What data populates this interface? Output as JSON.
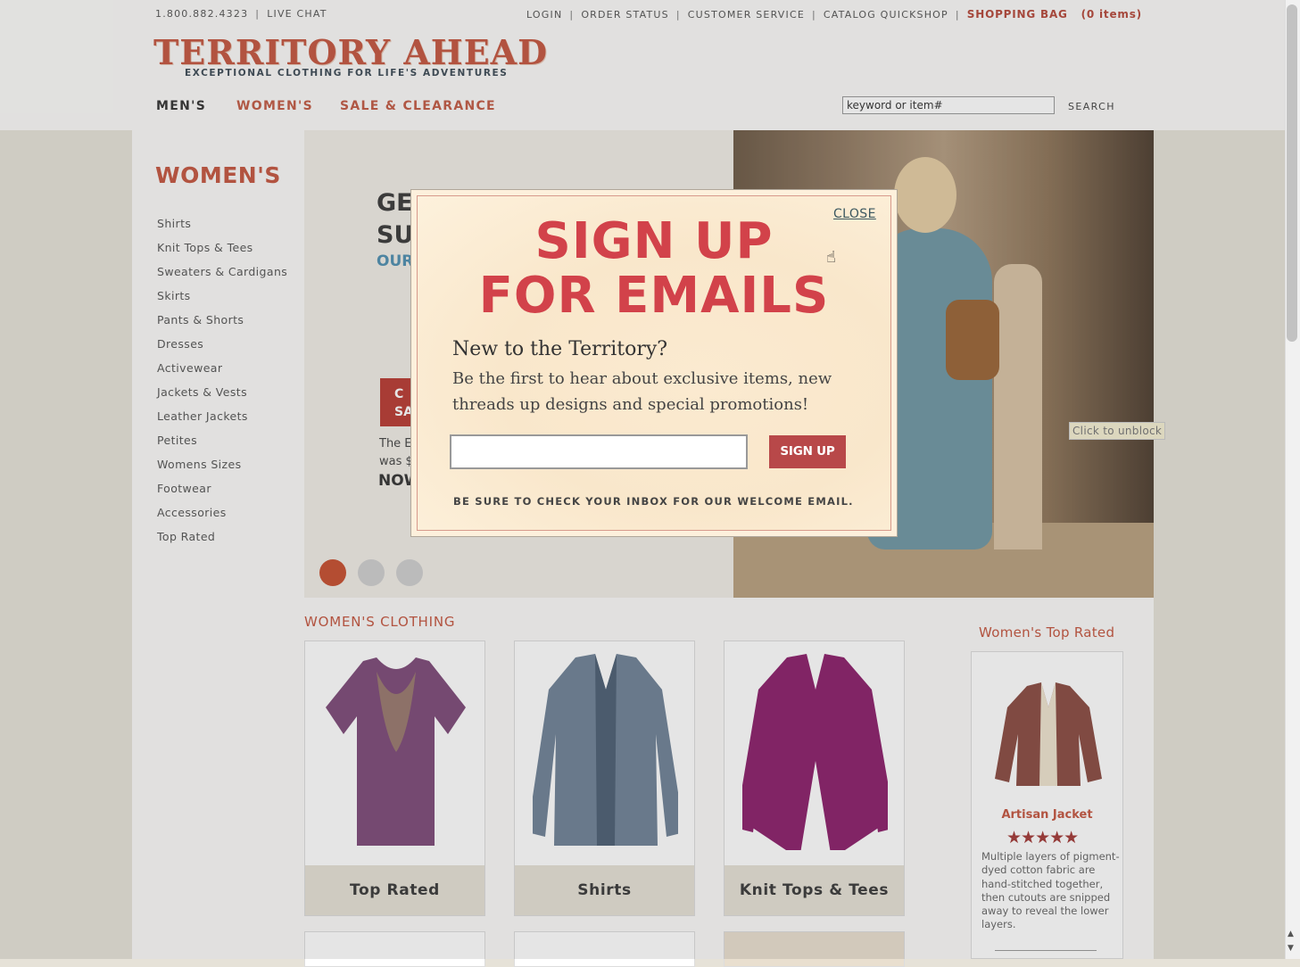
{
  "header": {
    "phone": "1.800.882.4323",
    "live_chat": "LIVE CHAT",
    "utility_links": [
      "LOGIN",
      "ORDER STATUS",
      "CUSTOMER SERVICE",
      "CATALOG QUICKSHOP"
    ],
    "shopping_bag": "SHOPPING BAG   (0 items)",
    "logo": "TERRITORY AHEAD",
    "tagline": "EXCEPTIONAL CLOTHING FOR LIFE'S ADVENTURES",
    "nav": {
      "men": "MEN'S",
      "women": "WOMEN'S",
      "sale": "SALE & CLEARANCE"
    },
    "search": {
      "value": "keyword or item#",
      "button": "SEARCH"
    }
  },
  "sidebar": {
    "title": "WOMEN'S",
    "items": [
      "Shirts",
      "Knit Tops & Tees",
      "Sweaters & Cardigans",
      "Skirts",
      "Pants & Shorts",
      "Dresses",
      "Activewear",
      "Jackets & Vests",
      "Leather Jackets",
      "Petites",
      "Womens Sizes",
      "Footwear",
      "Accessories",
      "Top Rated"
    ]
  },
  "hero": {
    "frag_ge": "GE",
    "frag_su": "SU",
    "frag_our": "OUR",
    "frag_btn": "C\nSA",
    "frag_the": "The E",
    "frag_was": "was $",
    "frag_now": "NOW",
    "unblock": "Click to unblock",
    "active_slide": 1,
    "slide_count": 3
  },
  "womens_clothing": {
    "title": "WOMEN'S CLOTHING",
    "cards": [
      "Top Rated",
      "Shirts",
      "Knit Tops & Tees"
    ]
  },
  "top_rated": {
    "title": "Women's Top Rated",
    "product": "Artisan Jacket",
    "rating": 4.5,
    "stars": "★★★★★",
    "description": "Multiple layers of pigment-dyed cotton fabric are hand-stitched together, then cutouts are snipped away to reveal the lower layers."
  },
  "modal": {
    "close": "CLOSE",
    "title_line1": "SIGN UP",
    "title_line2": "FOR EMAILS",
    "question": "New to the Territory?",
    "description": "Be the first to hear about exclusive items, new threads up designs and special promotions!",
    "email_value": "",
    "signup_button": "SIGN UP",
    "note": "BE SURE TO CHECK YOUR INBOX FOR OUR WELCOME EMAIL."
  },
  "colors": {
    "brand": "#c4553f",
    "modal_title": "#d2424a",
    "signup_button": "#b84849",
    "slide_active": "#c64e2f"
  }
}
